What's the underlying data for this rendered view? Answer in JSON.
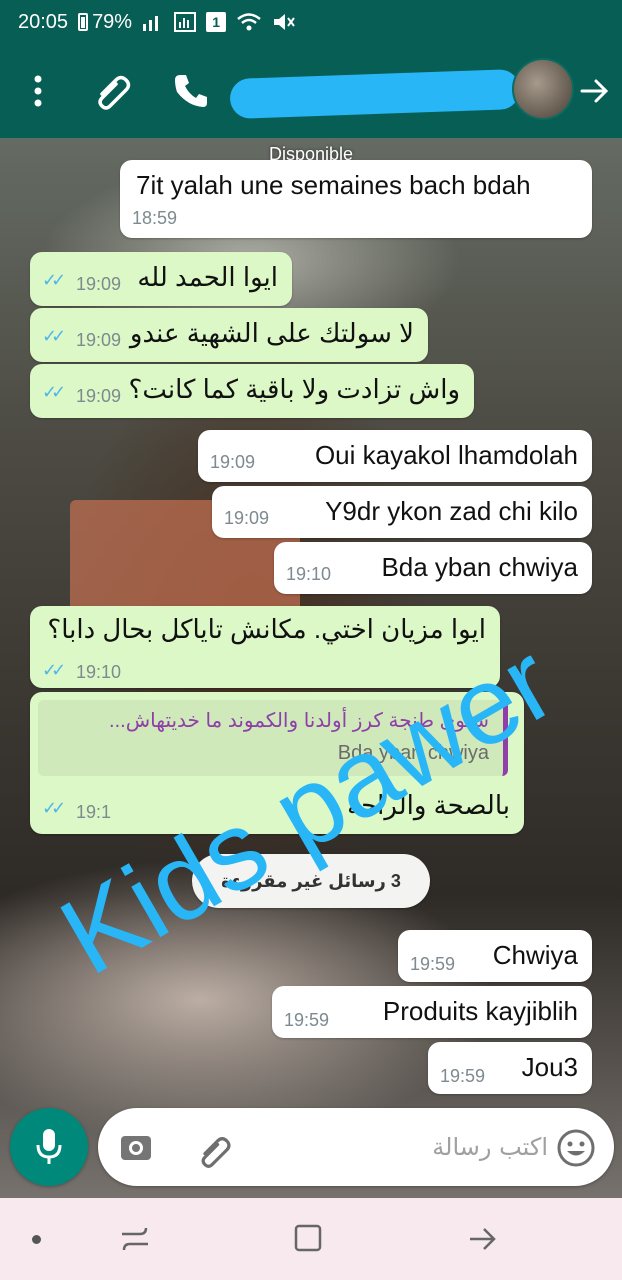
{
  "status_bar": {
    "time": "20:05",
    "battery": "79%",
    "sim": "1"
  },
  "header": {
    "presence": "Disponible"
  },
  "messages": [
    {
      "dir": "in",
      "text": "7it yalah une semaines bach bdah",
      "time": "18:59"
    },
    {
      "dir": "out",
      "text": "ايوا الحمد لله",
      "time": "19:09"
    },
    {
      "dir": "out",
      "text": "لا سولتك على الشهية عندو",
      "time": "19:09"
    },
    {
      "dir": "out",
      "text": "واش تزادت ولا باقية كما كانت؟",
      "time": "19:09"
    },
    {
      "dir": "in",
      "text": "Oui kayakol lhamdolah",
      "time": "19:09"
    },
    {
      "dir": "in",
      "text": "Y9dr ykon zad chi kilo",
      "time": "19:09"
    },
    {
      "dir": "in",
      "text": "Bda yban chwiya",
      "time": "19:10"
    },
    {
      "dir": "out",
      "text": "ايوا مزيان اختي. مكانش تاياكل بحال دابا؟",
      "time": "19:10"
    },
    {
      "dir": "out",
      "text": "بالصحة والراحة",
      "time": "19:1",
      "quote_author": "سلوى طنجة كرز أولدنا والكموند ما خديتهاش...",
      "quote_text": "Bda yban chwiya"
    },
    {
      "dir": "in",
      "text": "Chwiya",
      "time": "19:59"
    },
    {
      "dir": "in",
      "text": "Produits kayjiblih",
      "time": "19:59"
    },
    {
      "dir": "in",
      "text": "Jou3",
      "time": "19:59"
    }
  ],
  "unread_banner": "3 رسائل غير مقروءة",
  "watermark": "Kids pawer",
  "composer": {
    "placeholder": "اكتب رسالة"
  },
  "colors": {
    "header": "#075e54",
    "outgoing": "#dcf8c6",
    "incoming": "#ffffff",
    "read_ticks": "#4fb6ec",
    "mic": "#00897b",
    "quote_bar": "#8e3fa8"
  },
  "icons": [
    "menu-icon",
    "paperclip-icon",
    "phone-icon",
    "forward-icon",
    "camera-icon",
    "emoji-icon",
    "mic-icon"
  ]
}
